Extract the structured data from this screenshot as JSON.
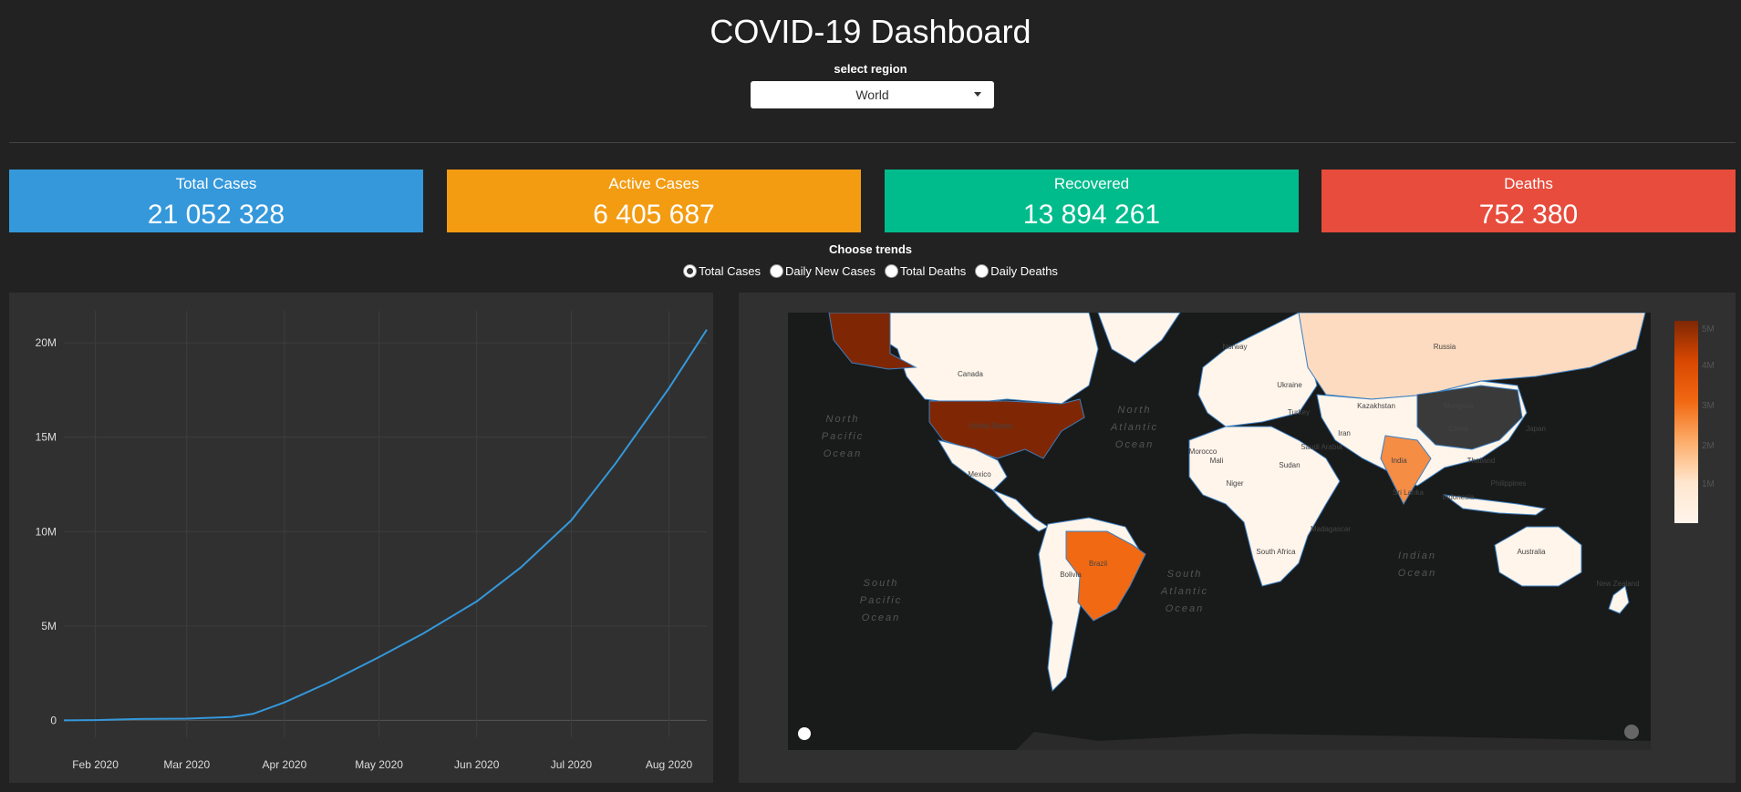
{
  "header": {
    "title": "COVID-19 Dashboard",
    "select_label": "select region",
    "region_value": "World"
  },
  "cards": [
    {
      "label": "Total Cases",
      "value": "21 052 328",
      "color": "#3498db"
    },
    {
      "label": "Active Cases",
      "value": "6 405 687",
      "color": "#f39c12"
    },
    {
      "label": "Recovered",
      "value": "13 894 261",
      "color": "#00bc8c"
    },
    {
      "label": "Deaths",
      "value": "752 380",
      "color": "#e74c3c"
    }
  ],
  "trends": {
    "label": "Choose trends",
    "options": [
      "Total Cases",
      "Daily New Cases",
      "Total Deaths",
      "Daily Deaths"
    ],
    "selected": "Total Cases"
  },
  "chart_data": {
    "type": "line",
    "x": [
      "2020-01-22",
      "2020-02-01",
      "2020-02-15",
      "2020-03-01",
      "2020-03-15",
      "2020-03-22",
      "2020-04-01",
      "2020-04-15",
      "2020-05-01",
      "2020-05-15",
      "2020-06-01",
      "2020-06-15",
      "2020-07-01",
      "2020-07-15",
      "2020-08-01",
      "2020-08-13"
    ],
    "y": [
      0,
      0.012,
      0.07,
      0.09,
      0.17,
      0.34,
      0.95,
      2.0,
      3.35,
      4.6,
      6.3,
      8.1,
      10.6,
      13.6,
      17.6,
      20.7
    ],
    "y_unit": "M",
    "yticks": [
      "0",
      "5M",
      "10M",
      "15M",
      "20M"
    ],
    "ytick_values": [
      0,
      5,
      10,
      15,
      20
    ],
    "xticks": [
      "Feb 2020",
      "Mar 2020",
      "Apr 2020",
      "May 2020",
      "Jun 2020",
      "Jul 2020",
      "Aug 2020"
    ],
    "xtick_dates": [
      "2020-02-01",
      "2020-03-01",
      "2020-04-01",
      "2020-05-01",
      "2020-06-01",
      "2020-07-01",
      "2020-08-01"
    ],
    "x_range": [
      "2020-01-22",
      "2020-08-13"
    ],
    "ylim": [
      -0.9,
      21.7
    ],
    "line_color": "#3498db",
    "grid": true
  },
  "map": {
    "ocean_labels": [
      "North Pacific Ocean",
      "North Atlantic Ocean",
      "South Pacific Ocean",
      "South Atlantic Ocean",
      "Indian Ocean"
    ],
    "country_labels": [
      "Canada",
      "United States",
      "Mexico",
      "Brazil",
      "Bolivia",
      "Russia",
      "Kazakhstan",
      "Mongolia",
      "China",
      "India",
      "Iran",
      "Australia",
      "Japan",
      "Philippines",
      "Indonesia",
      "Sri Lanka",
      "Niger",
      "Sudan",
      "Mali",
      "Turkey",
      "South Africa",
      "Madagascar",
      "New Zealand",
      "Saudi Arabia",
      "Thailand",
      "Ukraine",
      "Norway",
      "Morocco"
    ],
    "colorscale": [
      "#7f2704",
      "#d94801",
      "#f16913",
      "#fdae6b",
      "#fee6ce",
      "#fff5eb"
    ],
    "colorbar_ticks": [
      "5M",
      "4M",
      "3M",
      "2M",
      "1M"
    ]
  }
}
